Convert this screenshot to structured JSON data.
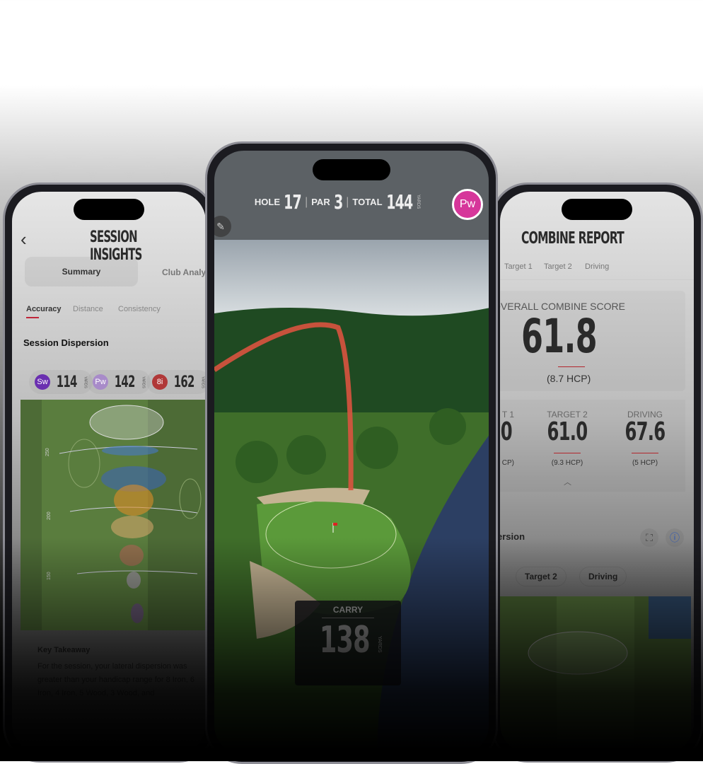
{
  "left_phone": {
    "title": "SESSION INSIGHTS",
    "back_icon": "chevron-left-icon",
    "segments": [
      "Summary",
      "Club Analy"
    ],
    "tabs": [
      "Accuracy",
      "Distance",
      "Consistency"
    ],
    "active_tab": "Accuracy",
    "section_title": "Session Dispersion",
    "clubs": [
      {
        "badge": "Sw",
        "distance": "114",
        "unit": "YARDS",
        "color": "#6a2fb0"
      },
      {
        "badge": "Pw",
        "distance": "142",
        "unit": "YARDS",
        "color": "#a88bc9"
      },
      {
        "badge": "8i",
        "distance": "162",
        "unit": "YARDS",
        "color": "#b03838"
      }
    ],
    "map_labels": [
      "250",
      "200",
      "150"
    ],
    "takeaway_title": "Key Takeaway",
    "takeaway_text": "For the session, your lateral dispersion was greater than your handicap range for 8 Iron, 6 Iron, 4 Iron, 5 Wood, 3 Wood, and"
  },
  "center_phone": {
    "hole_label": "HOLE",
    "hole": "17",
    "par_label": "PAR",
    "par": "3",
    "total_label": "TOTAL",
    "total": "144",
    "total_unit": "YARDS",
    "club_badge": "Pw",
    "club_color": "#d6369a",
    "edit_icon": "pencil-icon",
    "carry_label": "CARRY",
    "carry": "138",
    "carry_unit": "YARDS"
  },
  "right_phone": {
    "title": "COMBINE REPORT",
    "tabs": [
      "Target 1",
      "Target 2",
      "Driving"
    ],
    "overall_label": "OVERALL COMBINE SCORE",
    "overall_score": "61.8",
    "overall_hcp": "(8.7 HCP)",
    "scores": [
      {
        "label": "T 1",
        "value": "0",
        "hcp": "CP)"
      },
      {
        "label": "TARGET 2",
        "value": "61.0",
        "hcp": "(9.3 HCP)"
      },
      {
        "label": "DRIVING",
        "value": "67.6",
        "hcp": "(5 HCP)"
      }
    ],
    "section_title": "ersion",
    "filter_chips": [
      "Target 2",
      "Driving"
    ],
    "accent": "#b3262e"
  }
}
